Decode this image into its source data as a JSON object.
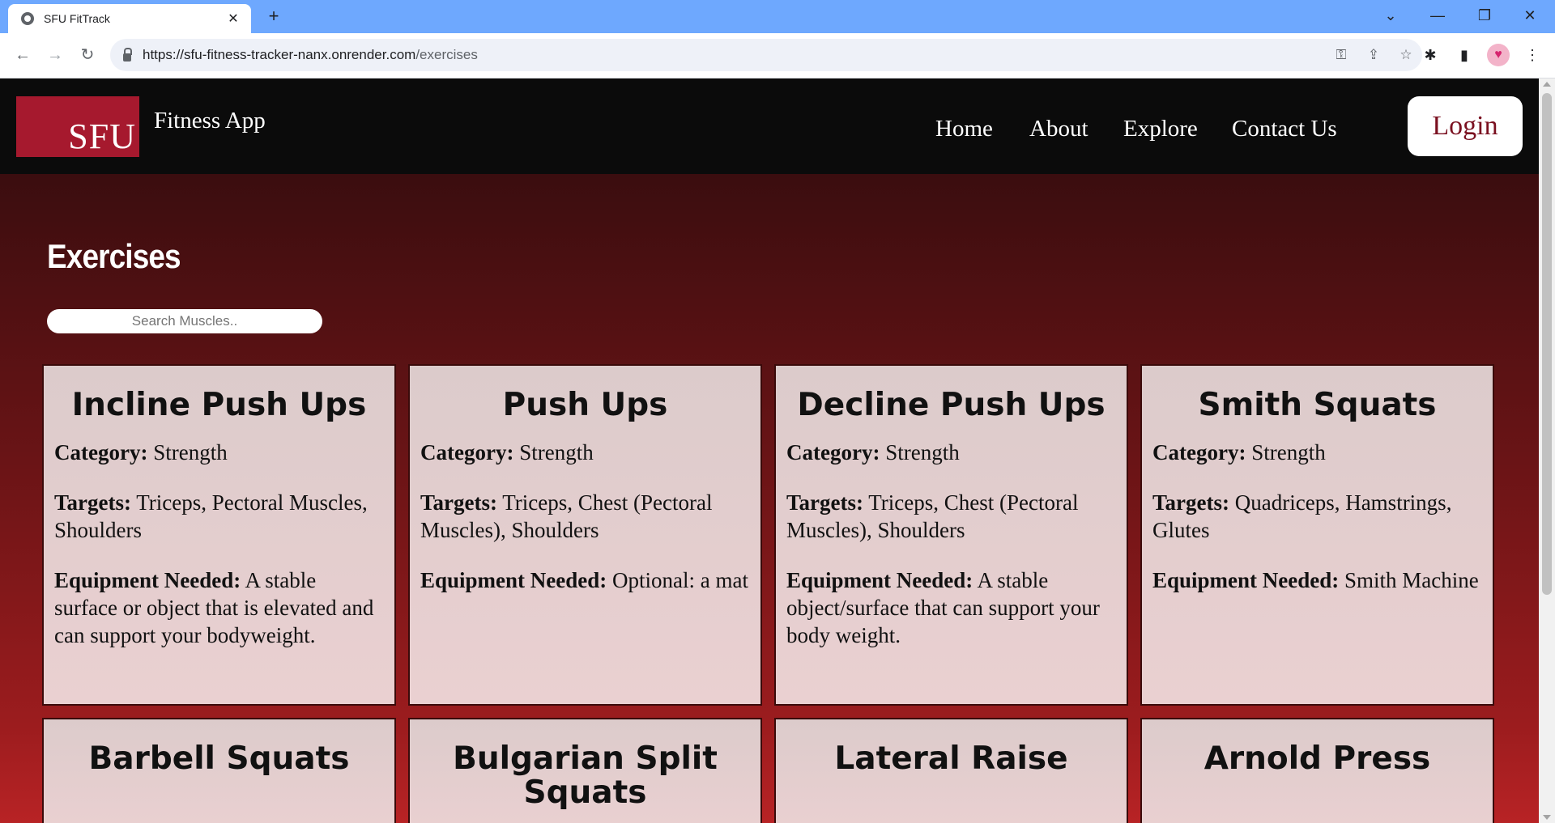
{
  "browser": {
    "tab_title": "SFU FitTrack",
    "url_host": "https://sfu-fitness-tracker-nanx.onrender.com",
    "url_path": "/exercises"
  },
  "header": {
    "logo_text": "SFU",
    "app_name": "Fitness App",
    "nav": [
      "Home",
      "About",
      "Explore",
      "Contact Us"
    ],
    "login_label": "Login"
  },
  "main": {
    "title": "Exercises",
    "search_placeholder": "Search Muscles..",
    "labels": {
      "category": "Category:",
      "targets": "Targets:",
      "equipment": "Equipment Needed:"
    },
    "exercises": [
      {
        "name": "Incline Push Ups",
        "category": "Strength",
        "targets": "Triceps, Pectoral Muscles, Shoulders",
        "equipment": "A stable surface or object that is elevated and can support your bodyweight."
      },
      {
        "name": "Push Ups",
        "category": "Strength",
        "targets": "Triceps, Chest (Pectoral Muscles), Shoulders",
        "equipment": "Optional: a mat"
      },
      {
        "name": "Decline Push Ups",
        "category": "Strength",
        "targets": "Triceps, Chest (Pectoral Muscles), Shoulders",
        "equipment": "A stable object/surface that can support your body weight."
      },
      {
        "name": "Smith Squats",
        "category": "Strength",
        "targets": "Quadriceps, Hamstrings, Glutes",
        "equipment": "Smith Machine"
      },
      {
        "name": "Barbell Squats"
      },
      {
        "name": "Bulgarian Split Squats"
      },
      {
        "name": "Lateral Raise"
      },
      {
        "name": "Arnold Press"
      }
    ]
  }
}
